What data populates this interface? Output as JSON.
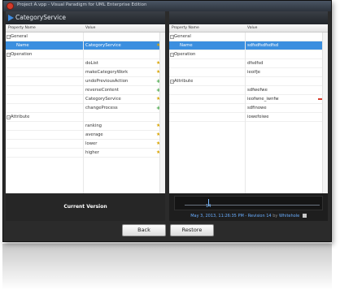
{
  "window": {
    "title": "Project A.vpp - Visual Paradigm for UML Enterprise Edition"
  },
  "service": {
    "title": "CategoryService"
  },
  "left": {
    "headers": [
      "Property Name",
      "Value"
    ],
    "rows": [
      {
        "kind": "group",
        "name": "General"
      },
      {
        "kind": "prop",
        "name": "Name",
        "value": "CategoryService",
        "selected": true,
        "icon": "star"
      },
      {
        "kind": "group",
        "name": "Operation"
      },
      {
        "kind": "prop",
        "name": "",
        "value": "doList",
        "icon": "star"
      },
      {
        "kind": "prop",
        "name": "",
        "value": "makeCategoryWork",
        "icon": "star"
      },
      {
        "kind": "prop",
        "name": "",
        "value": "undoPreviousAction",
        "icon": "plus"
      },
      {
        "kind": "prop",
        "name": "",
        "value": "reverseContent",
        "icon": "plus"
      },
      {
        "kind": "prop",
        "name": "",
        "value": "CategoryService",
        "icon": "star"
      },
      {
        "kind": "prop",
        "name": "",
        "value": "changeProcess",
        "icon": "plus"
      },
      {
        "kind": "group",
        "name": "Attribute"
      },
      {
        "kind": "prop",
        "name": "",
        "value": "ranking",
        "icon": "star"
      },
      {
        "kind": "prop",
        "name": "",
        "value": "average",
        "icon": "star"
      },
      {
        "kind": "prop",
        "name": "",
        "value": "lower",
        "icon": "star"
      },
      {
        "kind": "prop",
        "name": "",
        "value": "higher",
        "icon": "star"
      }
    ]
  },
  "right": {
    "headers": [
      "Property Name",
      "Value"
    ],
    "rows": [
      {
        "kind": "group",
        "name": "General"
      },
      {
        "kind": "prop",
        "name": "Name",
        "value": "sdfsdfsdfsdfsd",
        "selected": true
      },
      {
        "kind": "group",
        "name": "Operation"
      },
      {
        "kind": "prop",
        "name": "",
        "value": "dfsdfsd"
      },
      {
        "kind": "prop",
        "name": "",
        "value": "ieoifje"
      },
      {
        "kind": "group",
        "name": "Attribute"
      },
      {
        "kind": "prop",
        "name": "",
        "value": "sdfwefwe"
      },
      {
        "kind": "prop",
        "name": "",
        "value": "ieofwne_iwnfw",
        "icon": "minus"
      },
      {
        "kind": "prop",
        "name": "",
        "value": "sdfinowe"
      },
      {
        "kind": "prop",
        "name": "",
        "value": "iowefoiwe"
      }
    ]
  },
  "current_version_label": "Current Version",
  "timeline": {
    "revision_number": "14",
    "date_text": "May 3, 2013, 11:26:35 PM - Revision 14",
    "by_label": "by",
    "user": "Whitehole"
  },
  "buttons": {
    "back": "Back",
    "restore": "Restore"
  },
  "colors": {
    "selected": "#3b8fdf",
    "star": "#d9a400",
    "plus": "#2e9a2e",
    "minus": "#d93b2b",
    "accent": "#6aaeff"
  }
}
